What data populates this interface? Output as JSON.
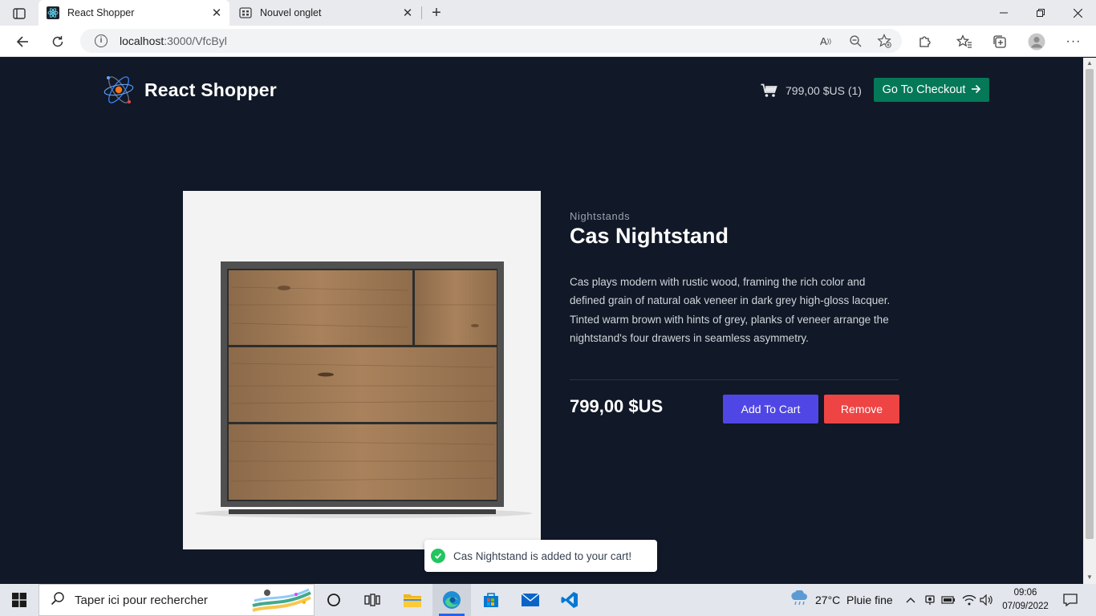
{
  "browser": {
    "tabs": [
      {
        "title": "React Shopper",
        "active": true,
        "icon": "react-icon"
      },
      {
        "title": "Nouvel onglet",
        "active": false,
        "icon": "new-tab-page-icon"
      }
    ],
    "url_host": "localhost",
    "url_path": ":3000/VfcByl"
  },
  "header": {
    "brand": "React Shopper",
    "cart_summary": "799,00 $US (1)",
    "checkout_label": "Go To Checkout"
  },
  "product": {
    "category": "Nightstands",
    "name": "Cas Nightstand",
    "description": "Cas plays modern with rustic wood, framing the rich color and defined grain of natural oak veneer in dark grey high-gloss lacquer. Tinted warm brown with hints of grey, planks of veneer arrange the nightstand's four drawers in seamless asymmetry.",
    "price": "799,00 $US",
    "add_label": "Add To Cart",
    "remove_label": "Remove"
  },
  "toast": {
    "message": "Cas Nightstand is added to your cart!"
  },
  "taskbar": {
    "search_placeholder": "Taper ici pour rechercher",
    "weather": "27°C  Pluie fine",
    "time": "09:06",
    "date": "07/09/2022"
  },
  "colors": {
    "page_bg": "#111827",
    "checkout": "#047857",
    "add_to_cart": "#4f46e5",
    "remove": "#ef4444",
    "toast_success": "#22c55e"
  }
}
